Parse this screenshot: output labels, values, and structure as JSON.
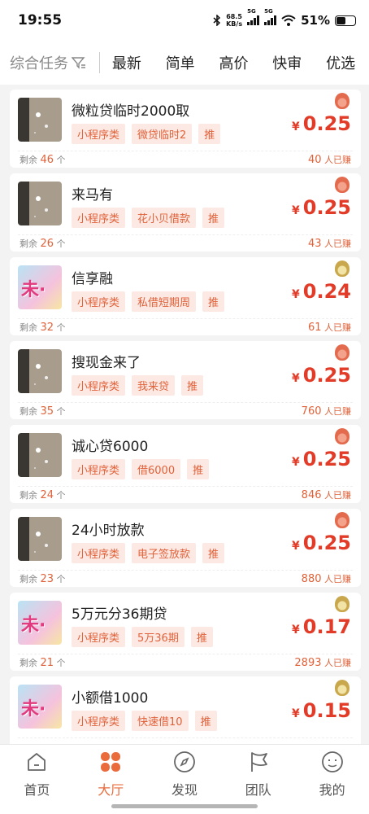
{
  "status_bar": {
    "time": "19:55",
    "net_speed_value": "68.5",
    "net_speed_unit": "KB/s",
    "sig1_label": "5G",
    "sig2_label": "5G",
    "battery": "51%"
  },
  "filter": {
    "main_label": "综合任务",
    "tabs": [
      "最新",
      "简单",
      "高价",
      "快审",
      "优选"
    ]
  },
  "labels": {
    "currency": "¥",
    "remaining_prefix": "剩余",
    "remaining_unit": "个",
    "earned_suffix": "人已赚"
  },
  "tasks": [
    {
      "title": "微粒贷临时2000取",
      "tags": [
        "小程序类",
        "微贷临时2",
        "推"
      ],
      "price": "0.25",
      "remaining": "46",
      "earned": "40",
      "thumb": "floor",
      "medal": "red"
    },
    {
      "title": "来马有",
      "tags": [
        "小程序类",
        "花小贝借款",
        "推"
      ],
      "price": "0.25",
      "remaining": "26",
      "earned": "43",
      "thumb": "floor",
      "medal": "red"
    },
    {
      "title": "信享融",
      "tags": [
        "小程序类",
        "私借短期周",
        "推"
      ],
      "price": "0.24",
      "remaining": "32",
      "earned": "61",
      "thumb": "colorful",
      "medal": "gold"
    },
    {
      "title": "搜现金来了",
      "tags": [
        "小程序类",
        "我来贷",
        "推"
      ],
      "price": "0.25",
      "remaining": "35",
      "earned": "760",
      "thumb": "floor",
      "medal": "red"
    },
    {
      "title": "诚心贷6000",
      "tags": [
        "小程序类",
        "借6000",
        "推"
      ],
      "price": "0.25",
      "remaining": "24",
      "earned": "846",
      "thumb": "floor",
      "medal": "red"
    },
    {
      "title": "24小时放款",
      "tags": [
        "小程序类",
        "电子签放款",
        "推"
      ],
      "price": "0.25",
      "remaining": "23",
      "earned": "880",
      "thumb": "floor",
      "medal": "red"
    },
    {
      "title": "5万元分36期贷",
      "tags": [
        "小程序类",
        "5万36期",
        "推"
      ],
      "price": "0.17",
      "remaining": "21",
      "earned": "2893",
      "thumb": "colorful",
      "medal": "gold"
    },
    {
      "title": "小额借1000",
      "tags": [
        "小程序类",
        "快速借10",
        "推"
      ],
      "price": "0.15",
      "remaining": "",
      "earned": "",
      "thumb": "colorful",
      "medal": "gold"
    }
  ],
  "nav": [
    {
      "label": "首页",
      "icon": "home-icon",
      "active": false
    },
    {
      "label": "大厅",
      "icon": "clover-icon",
      "active": true
    },
    {
      "label": "发现",
      "icon": "compass-icon",
      "active": false
    },
    {
      "label": "团队",
      "icon": "flag-icon",
      "active": false
    },
    {
      "label": "我的",
      "icon": "smile-icon",
      "active": false
    }
  ],
  "colors": {
    "accent": "#ea6b3c",
    "price": "#e23c28",
    "tag_bg": "#fde9e4"
  }
}
